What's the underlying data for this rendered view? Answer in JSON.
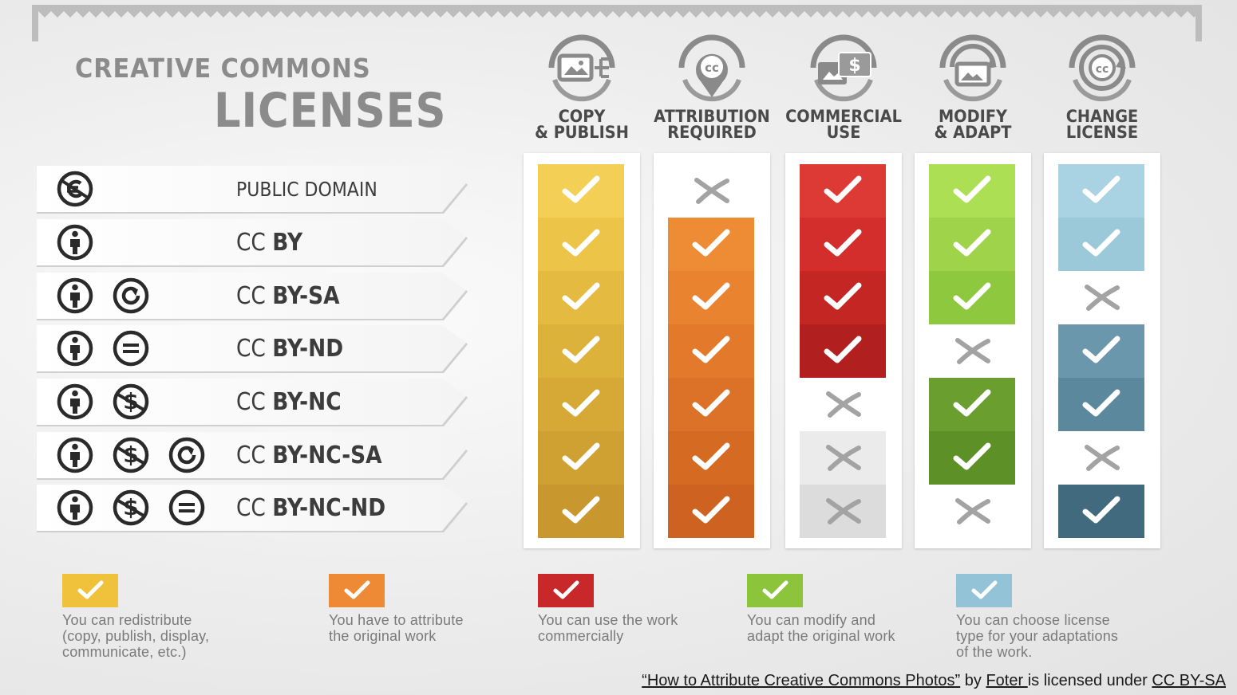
{
  "title": {
    "line1": "CREATIVE COMMONS",
    "line2": "LICENSES"
  },
  "columns": [
    {
      "label": "COPY\n& PUBLISH",
      "icon": "copy-publish-icon",
      "legend_text": "You can redistribute\n(copy, publish, display,\ncommunicate, etc.)",
      "legend_color": "#f0c23c"
    },
    {
      "label": "ATTRIBUTION\nREQUIRED",
      "icon": "attribution-cc-pin-icon",
      "legend_text": "You have to attribute\nthe original work",
      "legend_color": "#ee8a35"
    },
    {
      "label": "COMMERCIAL\nUSE",
      "icon": "commercial-dollar-icon",
      "legend_text": "You can use the work\ncommercially",
      "legend_color": "#c8282a"
    },
    {
      "label": "MODIFY\n& ADAPT",
      "icon": "modify-adapt-icon",
      "legend_text": "You can modify and\nadapt the original work",
      "legend_color": "#8cc43c"
    },
    {
      "label": "CHANGE\nLICENSE",
      "icon": "change-license-cc-icon",
      "legend_text": "You can choose license\ntype for your adaptations\nof the work.",
      "legend_color": "#93c3d6"
    }
  ],
  "licenses": [
    {
      "prefix": "PUBLIC DOMAIN",
      "bold": "",
      "icons": [
        "public-domain-icon"
      ],
      "permissions": [
        true,
        false,
        true,
        true,
        true
      ]
    },
    {
      "prefix": "CC ",
      "bold": "BY",
      "icons": [
        "attribution-icon"
      ],
      "permissions": [
        true,
        true,
        true,
        true,
        true
      ]
    },
    {
      "prefix": "CC ",
      "bold": "BY-SA",
      "icons": [
        "attribution-icon",
        "share-alike-icon"
      ],
      "permissions": [
        true,
        true,
        true,
        true,
        false
      ]
    },
    {
      "prefix": "CC ",
      "bold": "BY-ND",
      "icons": [
        "attribution-icon",
        "no-derivatives-icon"
      ],
      "permissions": [
        true,
        true,
        true,
        false,
        true
      ]
    },
    {
      "prefix": "CC ",
      "bold": "BY-NC",
      "icons": [
        "attribution-icon",
        "non-commercial-icon"
      ],
      "permissions": [
        true,
        true,
        false,
        true,
        true
      ]
    },
    {
      "prefix": "CC ",
      "bold": "BY-NC-SA",
      "icons": [
        "attribution-icon",
        "non-commercial-icon",
        "share-alike-icon"
      ],
      "permissions": [
        true,
        true,
        false,
        true,
        false
      ]
    },
    {
      "prefix": "CC ",
      "bold": "BY-NC-ND",
      "icons": [
        "attribution-icon",
        "non-commercial-icon",
        "no-derivatives-icon"
      ],
      "permissions": [
        true,
        true,
        false,
        false,
        true
      ]
    }
  ],
  "cell_colors": [
    [
      "#f3cf55",
      "#ebc448",
      "#e4bb40",
      "#ddb23b",
      "#d6a936",
      "#cfa032",
      "#c8972e"
    ],
    [
      "#ffffff",
      "#ee8c36",
      "#e98330",
      "#e37a2b",
      "#dc7227",
      "#d56a23",
      "#ce6220"
    ],
    [
      "#de3a35",
      "#d32e2b",
      "#c42624",
      "#b21f1f",
      "#ffffff",
      "#ebebeb",
      "#dcdcdc"
    ],
    [
      "#addf55",
      "#9fd44a",
      "#8ec83f",
      "#ffffff",
      "#6a9e2e",
      "#5e9028",
      "#ffffff"
    ],
    [
      "#a9d3e2",
      "#9cc9d9",
      "#ffffff",
      "#6b97ac",
      "#5b889d",
      "#ffffff",
      "#416a7e"
    ]
  ],
  "credit": {
    "work_title": "“How to Attribute Creative Commons Photos”",
    "by": " by ",
    "author": "Foter ",
    "licensed": "is licensed under ",
    "license": "CC BY-SA"
  }
}
